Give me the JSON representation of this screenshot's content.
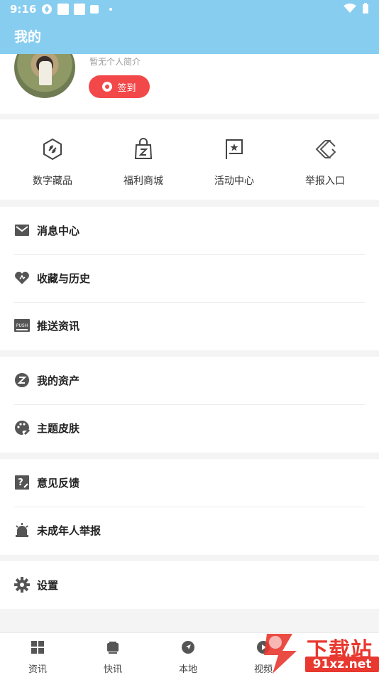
{
  "status_bar": {
    "time": "9:16"
  },
  "header": {
    "title": "我的"
  },
  "profile": {
    "bio": "暂无个人简介",
    "signin_label": "签到"
  },
  "quick_grid": [
    {
      "label": "数字藏品",
      "icon": "digital-collectible-icon"
    },
    {
      "label": "福利商城",
      "icon": "shopping-bag-icon"
    },
    {
      "label": "活动中心",
      "icon": "flag-star-icon"
    },
    {
      "label": "举报入口",
      "icon": "report-arrow-icon"
    }
  ],
  "menu_groups": [
    [
      {
        "label": "消息中心",
        "icon": "mail-icon"
      },
      {
        "label": "收藏与历史",
        "icon": "heart-icon"
      },
      {
        "label": "推送资讯",
        "icon": "push-icon"
      }
    ],
    [
      {
        "label": "我的资产",
        "icon": "asset-coin-icon"
      },
      {
        "label": "主题皮肤",
        "icon": "palette-icon"
      }
    ],
    [
      {
        "label": "意见反馈",
        "icon": "feedback-icon"
      },
      {
        "label": "未成年人举报",
        "icon": "alarm-icon"
      }
    ],
    [
      {
        "label": "设置",
        "icon": "gear-icon"
      }
    ]
  ],
  "tabs": [
    {
      "label": "资讯",
      "icon": "grid-icon"
    },
    {
      "label": "快讯",
      "icon": "tv-icon"
    },
    {
      "label": "本地",
      "icon": "compass-icon"
    },
    {
      "label": "视频",
      "icon": "video-icon"
    }
  ],
  "watermark": {
    "text": "下载站",
    "url": "91xz.net"
  },
  "colors": {
    "header": "#87cdf0",
    "accent": "#f2484a"
  }
}
